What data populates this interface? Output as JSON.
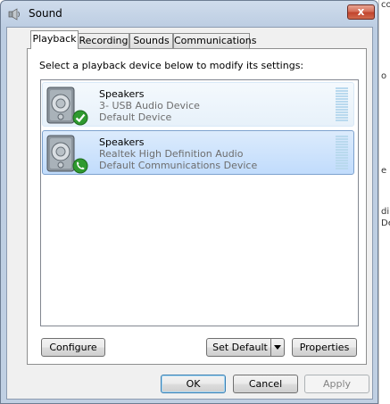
{
  "window": {
    "title": "Sound",
    "close_label": "x"
  },
  "tabs": [
    {
      "label": "Playback",
      "active": true
    },
    {
      "label": "Recording",
      "active": false
    },
    {
      "label": "Sounds",
      "active": false
    },
    {
      "label": "Communications",
      "active": false
    }
  ],
  "instructions": "Select a playback device below to modify its settings:",
  "devices": [
    {
      "name": "Speakers",
      "description": "3- USB Audio Device",
      "status": "Default Device",
      "status_icon": "green-checkmark-icon",
      "selected": false
    },
    {
      "name": "Speakers",
      "description": "Realtek High Definition Audio",
      "status": "Default Communications Device",
      "status_icon": "green-phone-icon",
      "selected": true
    }
  ],
  "buttons": {
    "configure": "Configure",
    "set_default": "Set Default",
    "properties": "Properties",
    "ok": "OK",
    "cancel": "Cancel",
    "apply": "Apply"
  },
  "background_fragments": [
    "co",
    "o",
    "e",
    "di",
    "De"
  ],
  "colors": {
    "selection": "#c1dcfc",
    "close_button": "#c1442e",
    "status_green": "#2f9a2f"
  }
}
